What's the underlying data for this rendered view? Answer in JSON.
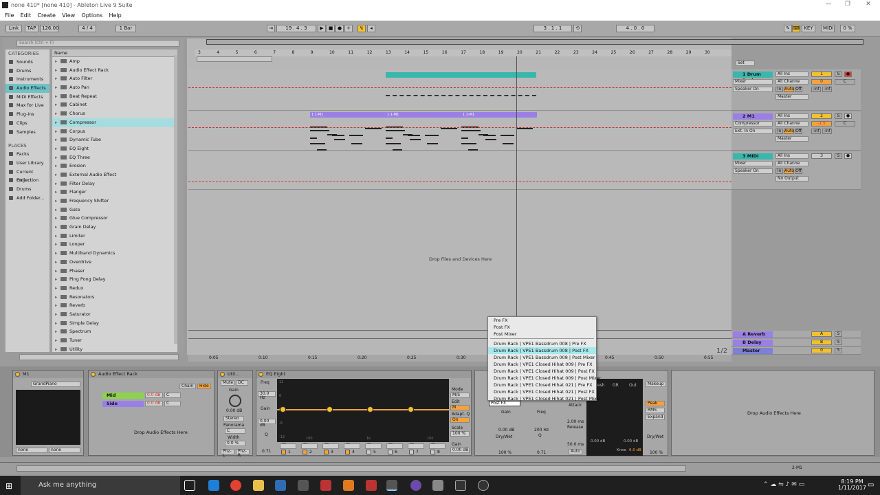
{
  "window": {
    "title": "none 410*  [none 410] - Ableton Live 9 Suite"
  },
  "menu": [
    "File",
    "Edit",
    "Create",
    "View",
    "Options",
    "Help"
  ],
  "transport": {
    "link": "Link",
    "tap": "TAP",
    "tempo": "126.00",
    "sig": "4 / 4",
    "quant": "1 Bar",
    "position": "19 .  4 .  3",
    "loop_start": "3 .  1 .  1",
    "loop_len": "4 .  0 .  0",
    "key": "KEY",
    "midi": "MIDI",
    "cpu": "0 %"
  },
  "browser": {
    "search_placeholder": "Search (Ctrl + F)",
    "categories_header": "CATEGORIES",
    "categories": [
      "Sounds",
      "Drums",
      "Instruments",
      "Audio Effects",
      "MIDI Effects",
      "Max for Live",
      "Plug-ins",
      "Clips",
      "Samples"
    ],
    "places_header": "PLACES",
    "places": [
      "Packs",
      "User Library",
      "Current Project",
      "Collection",
      "Drums",
      "Add Folder..."
    ],
    "name_header": "Name",
    "items": [
      "Amp",
      "Audio Effect Rack",
      "Auto Filter",
      "Auto Pan",
      "Beat Repeat",
      "Cabinet",
      "Chorus",
      "Compressor",
      "Corpus",
      "Dynamic Tube",
      "EQ Eight",
      "EQ Three",
      "Erosion",
      "External Audio Effect",
      "Filter Delay",
      "Flanger",
      "Frequency Shifter",
      "Gate",
      "Glue Compressor",
      "Grain Delay",
      "Limiter",
      "Looper",
      "Multiband Dynamics",
      "Overdrive",
      "Phaser",
      "Ping Pong Delay",
      "Redux",
      "Resonators",
      "Reverb",
      "Saturator",
      "Simple Delay",
      "Spectrum",
      "Tuner",
      "Utility"
    ]
  },
  "ruler": [
    "3",
    "4",
    "5",
    "6",
    "7",
    "8",
    "9",
    "10",
    "11",
    "12",
    "13",
    "14",
    "15",
    "16",
    "17",
    "18",
    "19",
    "20",
    "21",
    "22",
    "23",
    "24",
    "25",
    "26",
    "27",
    "28",
    "29",
    "30"
  ],
  "tracks": [
    {
      "name": "1 Drum Rack",
      "num": "1",
      "input": "All Ins",
      "channel": "All Channe",
      "device": "Mixer",
      "monitor": "Speaker On",
      "out": "Master",
      "vol": "0",
      "pan": "C",
      "inf1": "-inf",
      "inf2": "-inf"
    },
    {
      "name": "2 M1",
      "num": "2",
      "input": "All Ins",
      "channel": "All Channe",
      "device": "Compressor",
      "monitor": "Ext. In On",
      "out": "Master",
      "vol": "-1.5",
      "pan": "C",
      "inf1": "-inf",
      "inf2": "-inf",
      "clip_label": "1 1-M1"
    },
    {
      "name": "3 MIDI",
      "num": "3",
      "input": "All Ins",
      "channel": "All Channe",
      "device": "Mixer",
      "monitor": "Speaker On",
      "out": "No Output"
    }
  ],
  "returns": [
    {
      "name": "A Reverb",
      "letter": "A"
    },
    {
      "name": "B Delay",
      "letter": "B"
    },
    {
      "name": "Master",
      "letter": "0",
      "extra": "ii 1/2"
    }
  ],
  "monitor_opts": [
    "In",
    "Auto",
    "Off"
  ],
  "drop_text": "Drop Files and Devices Here",
  "page_indicator": "1/2",
  "bottom_ruler": [
    "0:05",
    "0:10",
    "0:15",
    "0:20",
    "0:25",
    "0:30",
    "0:35",
    "0:40",
    "0:45",
    "0:50",
    "0:55"
  ],
  "route_menu": {
    "items": [
      "Pre FX",
      "Post FX",
      "Post Mixer",
      "Drum Rack | VPE1 Bassdrum 008 | Pre FX",
      "Drum Rack | VPE1 Bassdrum 008 | Post FX",
      "Drum Rack | VPE1 Bassdrum 008 | Post Mixer",
      "Drum Rack | VPE1 Closed Hihat 009 | Pre FX",
      "Drum Rack | VPE1 Closed Hihat 009 | Post FX",
      "Drum Rack | VPE1 Closed Hihat 009 | Post Mixer",
      "Drum Rack | VPE1 Closed Hihat 021 | Pre FX",
      "Drum Rack | VPE1 Closed Hihat 021 | Post FX",
      "Drum Rack | VPE1 Closed Hihat 021 | Post Mixer"
    ],
    "selected_index": 4,
    "field_value": "Post FX"
  },
  "devices": {
    "m1": {
      "title": "M1",
      "preset": "GrandPiano",
      "a": "none",
      "b": "none"
    },
    "rack": {
      "title": "Audio Effect Rack",
      "chain": "Chain",
      "hide": "Hide",
      "chains": [
        "Mid",
        "Side"
      ],
      "db1": "0.0 dB",
      "db2": "0.0 dB",
      "pan": "C",
      "drop": "Drop Audio Effects Here"
    },
    "util": {
      "title": "Util...",
      "mute": "Mute",
      "dc": "DC",
      "gain_lbl": "Gain",
      "gain": "0.00 dB",
      "mode": "Stereo",
      "pan_lbl": "Panorama",
      "pan": "C",
      "width_lbl": "Width",
      "width": "0.0 %",
      "phz_l": "Phz-L",
      "phz_r": "Phz-R"
    },
    "eq": {
      "title": "EQ Eight",
      "freq_lbl": "Freq",
      "freq": "30.0 Hz",
      "gain_lbl": "Gain",
      "gain": "0.00 dB",
      "q_lbl": "Q",
      "q": "0.71",
      "mode_lbl": "Mode",
      "mode": "M/S",
      "edit_lbl": "Edit",
      "edit": "M",
      "adapt_lbl": "Adapt. Q",
      "adapt": "On",
      "scale_lbl": "Scale",
      "scale": "100 %",
      "out_gain_lbl": "Gain",
      "out_gain": "0.00 dB",
      "scale_db": [
        "12",
        "6",
        "0",
        "-6",
        "-12"
      ],
      "freq_marks": [
        "100",
        "1k",
        "10k"
      ],
      "bands": [
        "1",
        "2",
        "3",
        "4",
        "5",
        "6",
        "7",
        "8"
      ]
    },
    "glue": {
      "gain_lbl": "Gain",
      "gain": "0.00 dB",
      "freq_lbl": "Freq",
      "freq": "200 Hz",
      "q_lbl": "Q",
      "q": "0.71",
      "attack_lbl": "Attack",
      "attack": "2.00 ms",
      "release_lbl": "Release",
      "release": "50.0 ms",
      "auto": "Auto",
      "drywet_lbl": "Dry/Wet",
      "drywet": "100 %",
      "thresh": "Thresh",
      "gr": "GR",
      "out": "Out",
      "db1": "0.00 dB",
      "db2": "0.00 dB",
      "knee": "Knee",
      "knee_v": "6.0 dB"
    },
    "comp_right": {
      "makeup": "Makeup",
      "peak": "Peak",
      "rms": "RMS",
      "expand": "Expand",
      "drywet_lbl": "Dry/Wet",
      "drywet": "100 %"
    },
    "drop": "Drop Audio Effects Here"
  },
  "status": {
    "track": "2-M1"
  },
  "taskbar": {
    "search": "Ask me anything",
    "time": "8:19 PM",
    "date": "1/11/2017"
  },
  "colors": {
    "teal": "#39b7ad",
    "purple": "#9a7fe6",
    "orange": "#f4a33c",
    "sel": "#6fc2c6",
    "yellow": "#f2c12e"
  }
}
